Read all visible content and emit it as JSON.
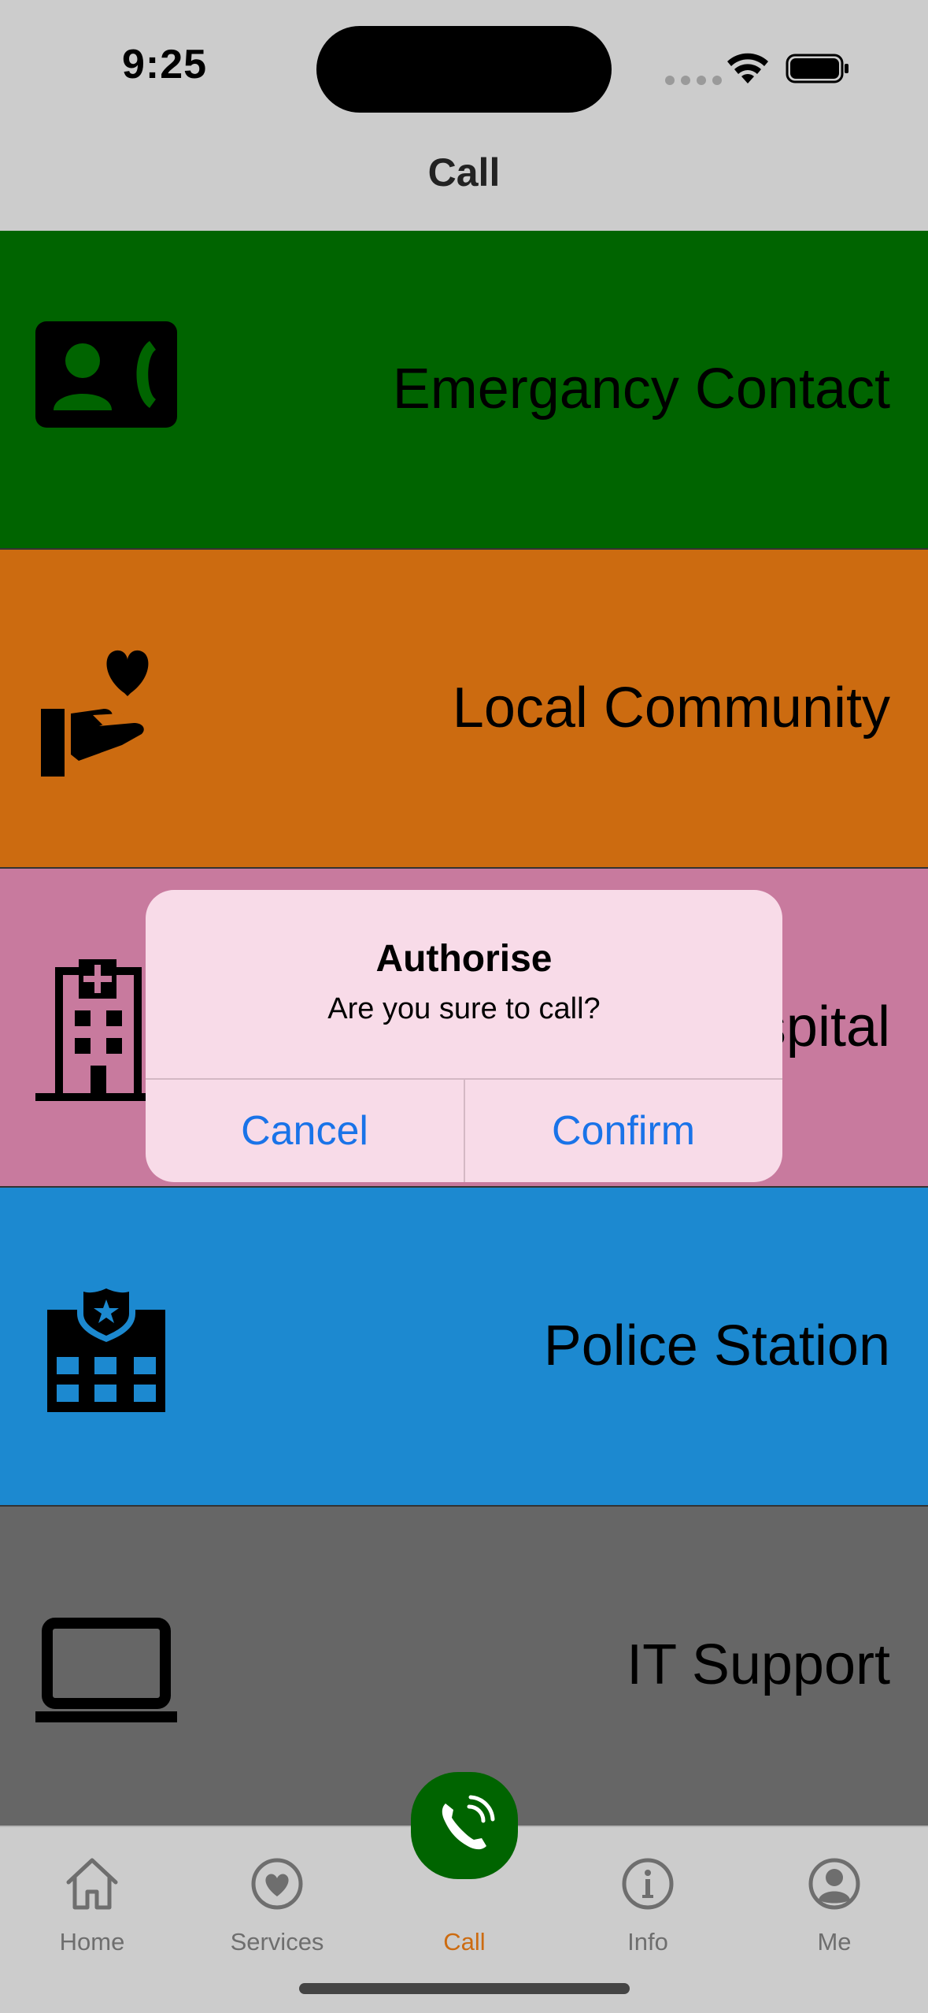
{
  "status_bar": {
    "time": "9:25"
  },
  "nav": {
    "title": "Call"
  },
  "contacts": [
    {
      "label": "Emergancy Contact",
      "icon": "contact-phone-icon",
      "color": "#006400"
    },
    {
      "label": "Local Community",
      "icon": "hand-heart-icon",
      "color": "#cc6b10"
    },
    {
      "label": "Hospital",
      "icon": "hospital-icon",
      "color": "#c87a9e"
    },
    {
      "label": "Police Station",
      "icon": "police-station-icon",
      "color": "#1c89d0"
    },
    {
      "label": "IT Support",
      "icon": "laptop-icon",
      "color": "#666666"
    }
  ],
  "alert": {
    "title": "Authorise",
    "message": "Are you sure to call?",
    "cancel_label": "Cancel",
    "confirm_label": "Confirm",
    "button_color": "#1a73e8"
  },
  "tab_bar": {
    "tabs": [
      {
        "label": "Home",
        "icon": "home-icon"
      },
      {
        "label": "Services",
        "icon": "heart-circle-icon"
      },
      {
        "label": "Call",
        "icon": "phone-icon",
        "active": true
      },
      {
        "label": "Info",
        "icon": "info-icon"
      },
      {
        "label": "Me",
        "icon": "profile-icon"
      }
    ],
    "active_color": "#cc6b10",
    "inactive_color": "#6e6e6e"
  }
}
